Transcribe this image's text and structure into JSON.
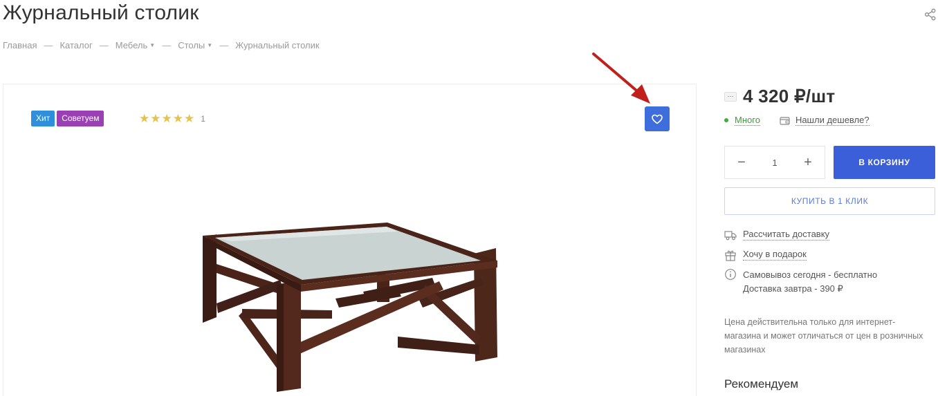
{
  "header": {
    "title": "Журнальный столик"
  },
  "breadcrumb": [
    {
      "label": "Главная",
      "caret": false
    },
    {
      "label": "Каталог",
      "caret": false
    },
    {
      "label": "Мебель",
      "caret": true
    },
    {
      "label": "Столы",
      "caret": true
    },
    {
      "label": "Журнальный столик",
      "caret": false
    }
  ],
  "breadcrumb_separator": "—",
  "gallery": {
    "badges": {
      "hit": "Хит",
      "recommend": "Советуем"
    },
    "rating": {
      "stars": 5,
      "count": "1"
    },
    "favorite_icon": "heart-icon"
  },
  "purchase": {
    "price": "4 320 ₽/шт",
    "more_icon": "···",
    "stock": "Много",
    "cheaper": "Нашли дешевле?",
    "quantity": "1",
    "minus": "−",
    "plus": "+",
    "add_to_cart": "В КОРЗИНУ",
    "buy_one_click": "КУПИТЬ В 1 КЛИК"
  },
  "delivery": {
    "calc": "Рассчитать доставку",
    "gift": "Хочу в подарок",
    "pickup": "Самовывоз сегодня - бесплатно",
    "tomorrow": "Доставка завтра - 390 ₽"
  },
  "note": "Цена действительна только для интернет-магазина и может отличаться от цен в розничных магазинах",
  "recommend_title": "Рекомендуем",
  "colors": {
    "accent": "#3b5fd9",
    "hit_badge": "#2f8fdc",
    "recommend_badge": "#9b3fb5",
    "star": "#e5c24a",
    "stock": "#3cae3c",
    "arrow": "#c0201c"
  }
}
